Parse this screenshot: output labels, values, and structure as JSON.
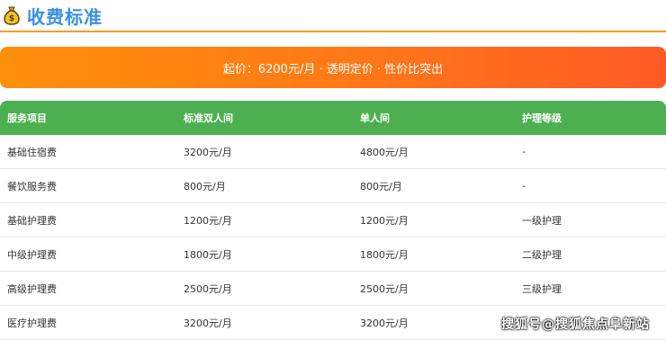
{
  "header": {
    "icon": "money-bag-icon",
    "title": "收费标准"
  },
  "banner": {
    "text": "起价：6200元/月 · 透明定价 · 性价比突出"
  },
  "table": {
    "headers": [
      "服务项目",
      "标准双人间",
      "单人间",
      "护理等级"
    ],
    "rows": [
      [
        "基础住宿费",
        "3200元/月",
        "4800元/月",
        "-"
      ],
      [
        "餐饮服务费",
        "800元/月",
        "800元/月",
        "-"
      ],
      [
        "基础护理费",
        "1200元/月",
        "1200元/月",
        "一级护理"
      ],
      [
        "中级护理费",
        "1800元/月",
        "1800元/月",
        "二级护理"
      ],
      [
        "高级护理费",
        "2500元/月",
        "2500元/月",
        "三级护理"
      ],
      [
        "医疗护理费",
        "3200元/月",
        "3200元/月",
        ""
      ]
    ]
  },
  "watermark": {
    "text": "搜狐号@搜狐焦点阜新站"
  },
  "colors": {
    "title": "#3a8fe0",
    "header_rule": "#ff9a1f",
    "banner_start": "#ff8f0a",
    "banner_end": "#ff5a26",
    "table_header": "#4caf50"
  }
}
